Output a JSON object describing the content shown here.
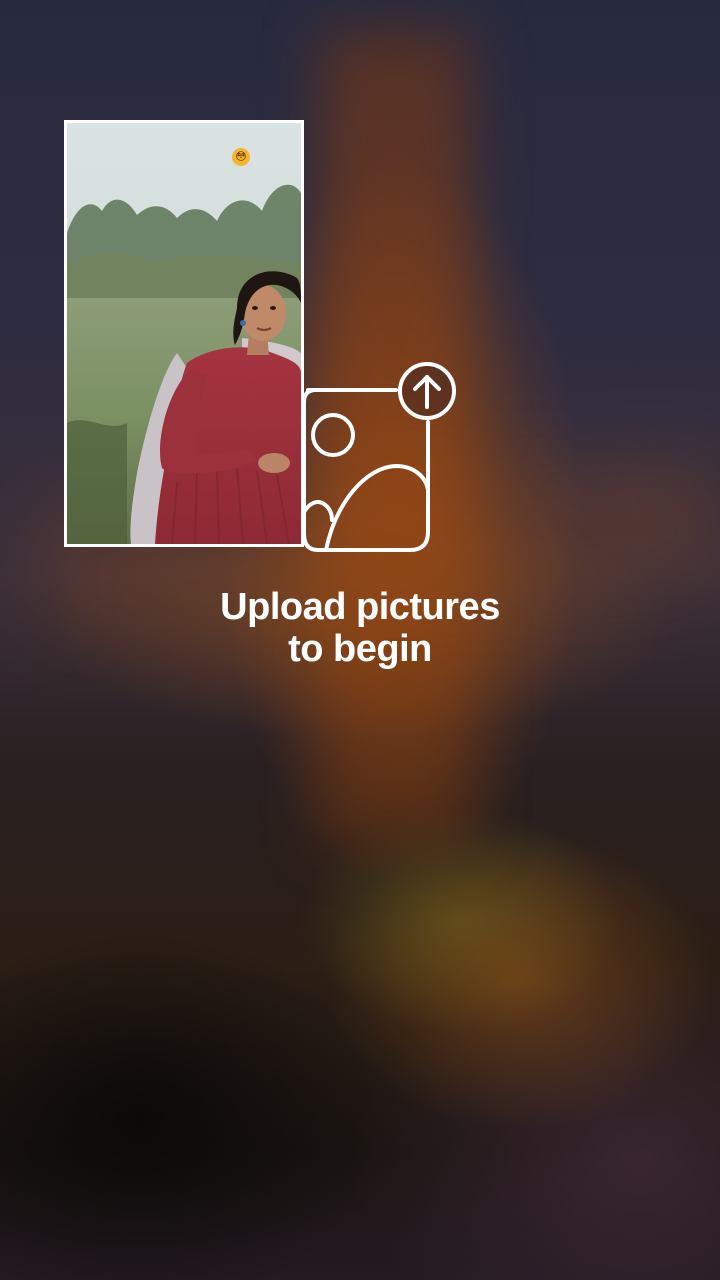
{
  "caption": {
    "line1": "Upload pictures",
    "line2": "to begin"
  },
  "preview": {
    "emoji": "😳"
  },
  "icons": {
    "upload": "image-upload-icon",
    "arrow": "arrow-up-icon"
  },
  "colors": {
    "text": "#ffffff",
    "card_border": "#ffffff",
    "accent_dress": "#a8323f"
  }
}
